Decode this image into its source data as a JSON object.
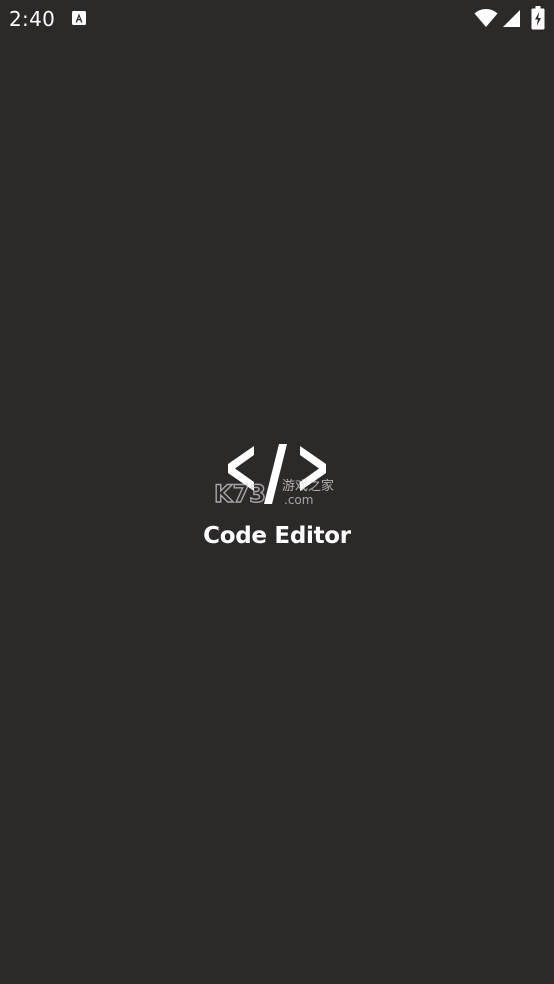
{
  "status_bar": {
    "time": "2:40",
    "notification_icon": "a-box-icon",
    "icons": [
      "wifi-icon",
      "signal-icon",
      "battery-charging-icon"
    ]
  },
  "splash": {
    "logo_icon": "code-brackets-icon",
    "title": "Code Editor",
    "watermark": "K73 游戏之家 .com"
  },
  "colors": {
    "background": "#2c2929",
    "foreground": "#ffffff"
  }
}
